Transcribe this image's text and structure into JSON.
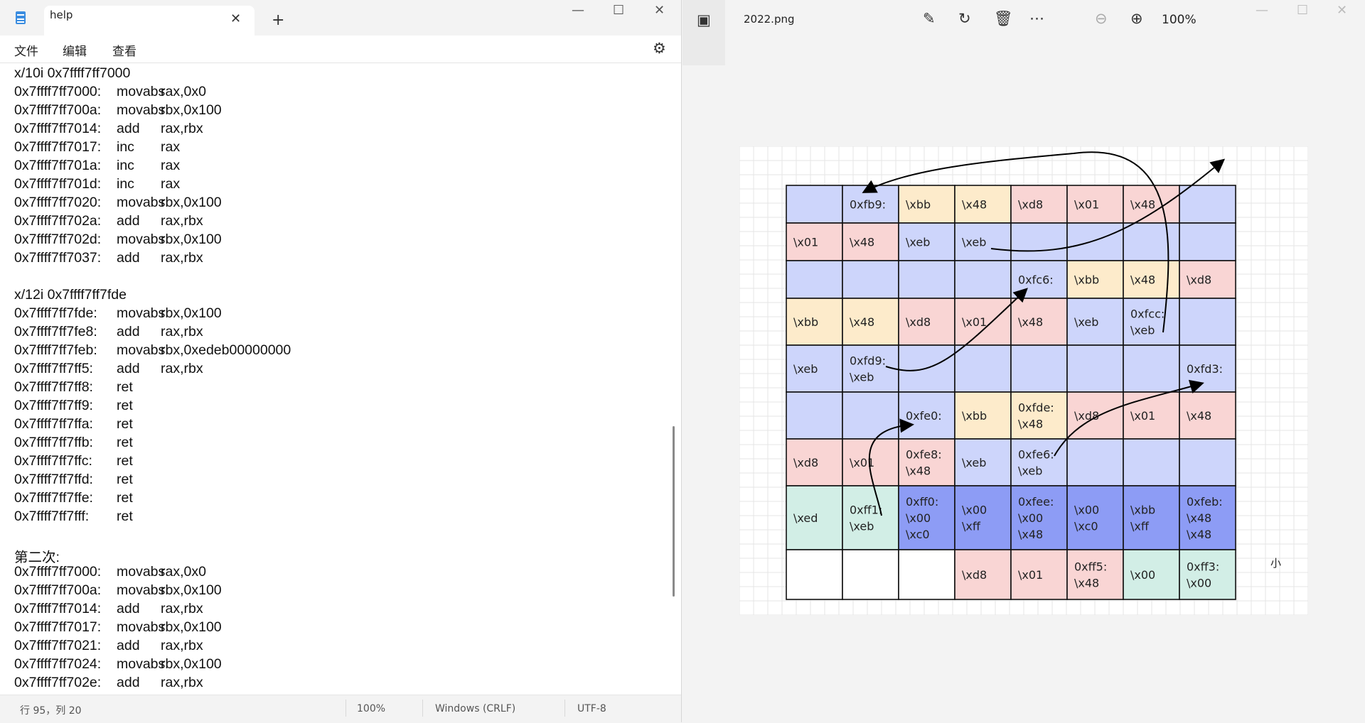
{
  "notepad": {
    "tab_title": "help",
    "menu": [
      "文件",
      "编辑",
      "查看"
    ],
    "lines": [
      {
        "text": "x/10i 0x7ffff7ff7000"
      },
      {
        "addr": "0x7ffff7ff7000:",
        "op": "movabs",
        "args": "rax,0x0"
      },
      {
        "addr": "0x7ffff7ff700a:",
        "op": "movabs",
        "args": "rbx,0x100"
      },
      {
        "addr": "0x7ffff7ff7014:",
        "op": "add",
        "args": "rax,rbx"
      },
      {
        "addr": "0x7ffff7ff7017:",
        "op": "inc",
        "args": "rax"
      },
      {
        "addr": "0x7ffff7ff701a:",
        "op": "inc",
        "args": "rax"
      },
      {
        "addr": "0x7ffff7ff701d:",
        "op": "inc",
        "args": "rax"
      },
      {
        "addr": "0x7ffff7ff7020:",
        "op": "movabs",
        "args": "rbx,0x100"
      },
      {
        "addr": "0x7ffff7ff702a:",
        "op": "add",
        "args": "rax,rbx"
      },
      {
        "addr": "0x7ffff7ff702d:",
        "op": "movabs",
        "args": "rbx,0x100"
      },
      {
        "addr": "0x7ffff7ff7037:",
        "op": "add",
        "args": "rax,rbx"
      },
      {
        "text": ""
      },
      {
        "text": "x/12i 0x7ffff7ff7fde"
      },
      {
        "addr": "0x7ffff7ff7fde:",
        "op": "movabs",
        "args": "rbx,0x100"
      },
      {
        "addr": "0x7ffff7ff7fe8:",
        "op": "add",
        "args": "rax,rbx"
      },
      {
        "addr": "0x7ffff7ff7feb:",
        "op": "movabs",
        "args": "rbx,0xedeb00000000"
      },
      {
        "addr": "0x7ffff7ff7ff5:",
        "op": "add",
        "args": "rax,rbx"
      },
      {
        "addr": "0x7ffff7ff7ff8:",
        "op": "ret",
        "args": ""
      },
      {
        "addr": "0x7ffff7ff7ff9:",
        "op": "ret",
        "args": ""
      },
      {
        "addr": "0x7ffff7ff7ffa:",
        "op": "ret",
        "args": ""
      },
      {
        "addr": "0x7ffff7ff7ffb:",
        "op": "ret",
        "args": ""
      },
      {
        "addr": "0x7ffff7ff7ffc:",
        "op": "ret",
        "args": ""
      },
      {
        "addr": "0x7ffff7ff7ffd:",
        "op": "ret",
        "args": ""
      },
      {
        "addr": "0x7ffff7ff7ffe:",
        "op": "ret",
        "args": ""
      },
      {
        "addr": "0x7ffff7ff7fff:",
        "op": "ret",
        "args": ""
      },
      {
        "text": ""
      },
      {
        "text": "第二次:"
      },
      {
        "addr": "0x7ffff7ff7000:",
        "op": "movabs",
        "args": "rax,0x0"
      },
      {
        "addr": "0x7ffff7ff700a:",
        "op": "movabs",
        "args": "rbx,0x100"
      },
      {
        "addr": "0x7ffff7ff7014:",
        "op": "add",
        "args": "rax,rbx"
      },
      {
        "addr": "0x7ffff7ff7017:",
        "op": "movabs",
        "args": "rbx,0x100"
      },
      {
        "addr": "0x7ffff7ff7021:",
        "op": "add",
        "args": "rax,rbx"
      },
      {
        "addr": "0x7ffff7ff7024:",
        "op": "movabs",
        "args": "rbx,0x100"
      },
      {
        "addr": "0x7ffff7ff702e:",
        "op": "add",
        "args": "rax,rbx"
      }
    ],
    "status": {
      "position": "行 95，列 20",
      "zoom": "100%",
      "line_ending": "Windows (CRLF)",
      "encoding": "UTF-8"
    }
  },
  "photos": {
    "file_name": "2022.png",
    "zoom": "100%",
    "icons": [
      "gallery-icon",
      "edit-image-icon",
      "rotate-icon",
      "delete-icon",
      "more-icon",
      "zoom-out-icon",
      "zoom-in-icon"
    ],
    "diagram": {
      "colors": {
        "blue": "#cdd5fb",
        "yellow": "#fdebcb",
        "pink": "#f9d5d4",
        "green": "#d2eee6",
        "dark_blue": "#8d9cf5",
        "white": "#ffffff"
      },
      "rows": [
        [
          {
            "c": "blue",
            "t": ""
          },
          {
            "c": "blue",
            "t": "0xfb9:"
          },
          {
            "c": "yellow",
            "t": "\\xbb"
          },
          {
            "c": "yellow",
            "t": "\\x48"
          },
          {
            "c": "pink",
            "t": "\\xd8"
          },
          {
            "c": "pink",
            "t": "\\x01"
          },
          {
            "c": "pink",
            "t": "\\x48"
          },
          {
            "c": "blue",
            "t": ""
          }
        ],
        [
          {
            "c": "pink",
            "t": "\\x01"
          },
          {
            "c": "pink",
            "t": "\\x48"
          },
          {
            "c": "blue",
            "t": "\\xeb"
          },
          {
            "c": "blue",
            "t": "\\xeb"
          },
          {
            "c": "blue",
            "t": ""
          },
          {
            "c": "blue",
            "t": ""
          },
          {
            "c": "blue",
            "t": ""
          },
          {
            "c": "blue",
            "t": ""
          }
        ],
        [
          {
            "c": "blue",
            "t": ""
          },
          {
            "c": "blue",
            "t": ""
          },
          {
            "c": "blue",
            "t": ""
          },
          {
            "c": "blue",
            "t": ""
          },
          {
            "c": "blue",
            "t": "0xfc6:"
          },
          {
            "c": "yellow",
            "t": "\\xbb"
          },
          {
            "c": "yellow",
            "t": "\\x48"
          },
          {
            "c": "pink",
            "t": "\\xd8"
          }
        ],
        [
          {
            "c": "yellow",
            "t": "\\xbb"
          },
          {
            "c": "yellow",
            "t": "\\x48"
          },
          {
            "c": "pink",
            "t": "\\xd8"
          },
          {
            "c": "pink",
            "t": "\\x01"
          },
          {
            "c": "pink",
            "t": "\\x48"
          },
          {
            "c": "blue",
            "t": "\\xeb"
          },
          {
            "c": "blue",
            "t": "0xfcc:\n\\xeb"
          },
          {
            "c": "blue",
            "t": ""
          }
        ],
        [
          {
            "c": "blue",
            "t": "\\xeb"
          },
          {
            "c": "blue",
            "t": "0xfd9:\n\\xeb"
          },
          {
            "c": "blue",
            "t": ""
          },
          {
            "c": "blue",
            "t": ""
          },
          {
            "c": "blue",
            "t": ""
          },
          {
            "c": "blue",
            "t": ""
          },
          {
            "c": "blue",
            "t": ""
          },
          {
            "c": "blue",
            "t": "0xfd3:"
          }
        ],
        [
          {
            "c": "blue",
            "t": ""
          },
          {
            "c": "blue",
            "t": ""
          },
          {
            "c": "blue",
            "t": "0xfe0:"
          },
          {
            "c": "yellow",
            "t": "\\xbb"
          },
          {
            "c": "yellow",
            "t": "0xfde:\n\\x48"
          },
          {
            "c": "pink",
            "t": "\\xd8"
          },
          {
            "c": "pink",
            "t": "\\x01"
          },
          {
            "c": "pink",
            "t": "\\x48"
          }
        ],
        [
          {
            "c": "pink",
            "t": "\\xd8"
          },
          {
            "c": "pink",
            "t": "\\x01"
          },
          {
            "c": "pink",
            "t": "0xfe8:\n\\x48"
          },
          {
            "c": "blue",
            "t": "\\xeb"
          },
          {
            "c": "blue",
            "t": "0xfe6:\n\\xeb"
          },
          {
            "c": "blue",
            "t": ""
          },
          {
            "c": "blue",
            "t": ""
          },
          {
            "c": "blue",
            "t": ""
          }
        ],
        [
          {
            "c": "green",
            "t": "\\xed"
          },
          {
            "c": "green",
            "t": "0xff1:\n\\xeb"
          },
          {
            "c": "dark_blue",
            "t": "0xff0:\n\\x00\n\\xc0"
          },
          {
            "c": "dark_blue",
            "t": "\\x00\n\\xff"
          },
          {
            "c": "dark_blue",
            "t": "0xfee:\n\\x00\n\\x48"
          },
          {
            "c": "dark_blue",
            "t": "\\x00\n\\xc0"
          },
          {
            "c": "dark_blue",
            "t": "\\xbb\n\\xff"
          },
          {
            "c": "dark_blue",
            "t": "0xfeb:\n\\x48\n\\x48"
          }
        ],
        [
          {
            "c": "white",
            "t": ""
          },
          {
            "c": "white",
            "t": ""
          },
          {
            "c": "white",
            "t": ""
          },
          {
            "c": "pink",
            "t": "\\xd8"
          },
          {
            "c": "pink",
            "t": "\\x01"
          },
          {
            "c": "pink",
            "t": "0xff5:\n\\x48"
          },
          {
            "c": "green",
            "t": "\\x00"
          },
          {
            "c": "green",
            "t": "0xff3:\n\\x00"
          }
        ]
      ],
      "side_label": "小"
    }
  }
}
